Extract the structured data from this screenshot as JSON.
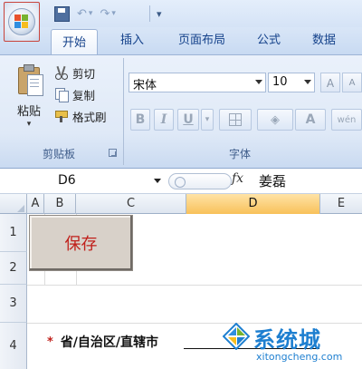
{
  "quick_access": {
    "dropdown_glyph": "▾"
  },
  "tabs": [
    {
      "label": "开始",
      "active": true
    },
    {
      "label": "插入"
    },
    {
      "label": "页面布局"
    },
    {
      "label": "公式"
    },
    {
      "label": "数据"
    }
  ],
  "clipboard": {
    "paste_label": "粘贴",
    "paste_dropdown": "▾",
    "cut_label": "剪切",
    "copy_label": "复制",
    "format_painter_label": "格式刷",
    "group_label": "剪贴板"
  },
  "font": {
    "font_name": "宋体",
    "font_size": "10",
    "bold": "B",
    "italic": "I",
    "underline": "U",
    "grow_font": "A",
    "shrink_font": "A",
    "font_color": "A",
    "phonetic": "wén",
    "group_label": "字体"
  },
  "formula_bar": {
    "name_box": "D6",
    "fx_label": "fx",
    "content": "姜磊"
  },
  "sheet": {
    "columns": [
      "A",
      "B",
      "C",
      "D",
      "E"
    ],
    "selected_column": "D",
    "rows": [
      "1",
      "2",
      "3",
      "4"
    ],
    "save_button": "保存",
    "required_star": "*",
    "field_label": "省/自治区/直辖市"
  },
  "watermark": {
    "text": "系统城",
    "url": "xitongcheng.com"
  },
  "colors": {
    "ribbon_blue": "#dfe9f7",
    "tab_text": "#15428b",
    "selected_header": "#f8c15a",
    "save_text": "#c0201b",
    "watermark": "#1e7fd0"
  }
}
